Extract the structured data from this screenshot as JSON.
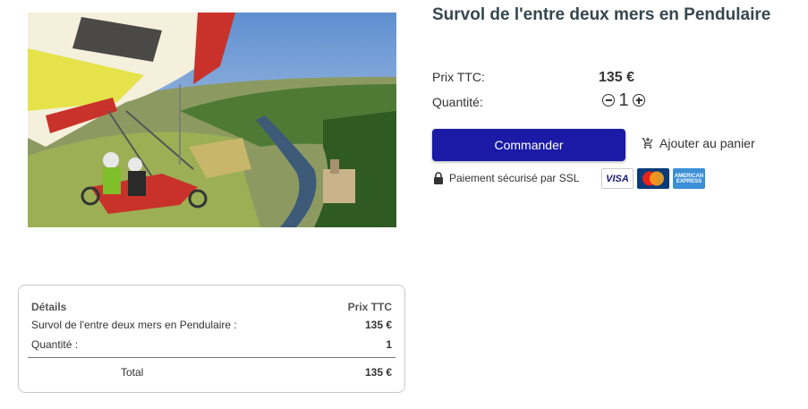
{
  "product": {
    "title": "Survol de l'entre deux mers en Pendulaire",
    "image_alt": "Pendulaire en vol au-dessus d'une rivière et d'un village"
  },
  "pricing": {
    "price_label": "Prix TTC:",
    "price_value": "135 €",
    "quantity_label": "Quantité:",
    "quantity_value": "1",
    "minus_icon": "minus-circle-icon",
    "plus_icon": "plus-circle-icon"
  },
  "actions": {
    "order_label": "Commander",
    "add_to_cart_label": "Ajouter au panier",
    "cart_icon": "cart-plus-icon",
    "order_color": "#1a1aa6"
  },
  "security": {
    "ssl_text": "Paiement sécurisé par SSL",
    "lock_icon": "lock-icon",
    "cards": [
      {
        "name": "visa",
        "label": "VISA"
      },
      {
        "name": "mastercard",
        "label": "MasterCard"
      },
      {
        "name": "amex",
        "label": "AMERICAN EXPRESS"
      }
    ]
  },
  "summary": {
    "header_details": "Détails",
    "header_price": "Prix TTC",
    "rows": [
      {
        "label": "Survol de l'entre deux mers en Pendulaire :",
        "value": "135 €"
      },
      {
        "label": "Quantité :",
        "value": "1"
      }
    ],
    "total_label": "Total",
    "total_value": "135 €"
  }
}
